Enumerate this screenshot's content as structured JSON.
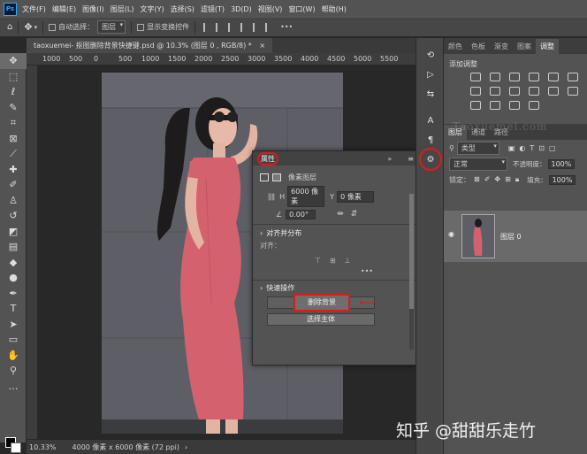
{
  "app": {
    "logo": "Ps"
  },
  "menu": [
    "文件(F)",
    "编辑(E)",
    "图像(I)",
    "图层(L)",
    "文字(Y)",
    "选择(S)",
    "滤镜(T)",
    "3D(D)",
    "视图(V)",
    "窗口(W)",
    "帮助(H)"
  ],
  "options_bar": {
    "auto_select_label": "自动选择：",
    "auto_select_value": "图层",
    "show_transform_label": "显示变换控件"
  },
  "document": {
    "tab_title": "taoxuemei- 抠图删除背景快捷键.psd @ 10.3% (图层 0 , RGB/8) *",
    "close_symbol": "×"
  },
  "ruler": {
    "ticks": [
      "1000",
      "500",
      "0",
      "500",
      "1000",
      "1500",
      "2000",
      "2500",
      "3000",
      "3500",
      "4000",
      "4500",
      "5000",
      "5500"
    ]
  },
  "status": {
    "zoom": "10.33%",
    "doc_info": "4000 像素 x 6000 像素 (72 ppi)"
  },
  "properties_panel": {
    "title": "属性",
    "layer_type": "像素图层",
    "h_label": "H",
    "h_value": "6000 像素",
    "y_label": "Y",
    "y_value": "0 像素",
    "angle_value": "0.00°",
    "align_section": "对齐并分布",
    "align_label": "对齐：",
    "quick_section": "快速操作",
    "remove_bg_button": "删除背景",
    "select_subject_button": "选择主体",
    "more_symbol": "•••"
  },
  "right_panel": {
    "top_tabs": [
      "颜色",
      "色板",
      "渐变",
      "图案",
      "调整"
    ],
    "active_top_tab": "调整",
    "adjust_title": "添加调整",
    "layer_tabs": [
      "图层",
      "通道",
      "路径"
    ],
    "filter_kind": "类型",
    "blend_mode": "正常",
    "opacity_label": "不透明度：",
    "opacity_value": "100%",
    "lock_label": "锁定：",
    "fill_label": "填充：",
    "fill_value": "100%",
    "layer_name": "图层 0"
  },
  "watermarks": {
    "site": "Taoxuemei.com",
    "zhihu": "知乎 @甜甜乐走竹"
  },
  "colors": {
    "highlight_ring": "#e0191a",
    "dress": "#d4626e",
    "wall": "#5e5f66"
  },
  "icons": {
    "toolbar": [
      "move-icon",
      "marquee-icon",
      "lasso-icon",
      "quick-select-icon",
      "crop-icon",
      "frame-icon",
      "eyedropper-icon",
      "healing-icon",
      "brush-icon",
      "clone-stamp-icon",
      "history-brush-icon",
      "eraser-icon",
      "gradient-icon",
      "blur-icon",
      "dodge-icon",
      "pen-icon",
      "type-icon",
      "path-select-icon",
      "rectangle-icon",
      "hand-icon",
      "zoom-icon",
      "more-icon"
    ]
  }
}
